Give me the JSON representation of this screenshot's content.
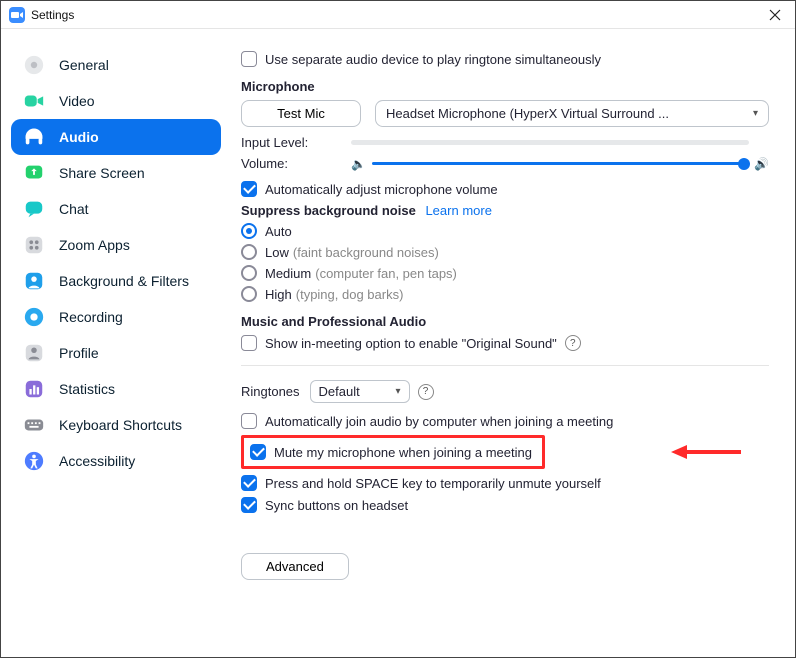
{
  "window": {
    "title": "Settings"
  },
  "sidebar": {
    "items": [
      {
        "label": "General"
      },
      {
        "label": "Video"
      },
      {
        "label": "Audio"
      },
      {
        "label": "Share Screen"
      },
      {
        "label": "Chat"
      },
      {
        "label": "Zoom Apps"
      },
      {
        "label": "Background & Filters"
      },
      {
        "label": "Recording"
      },
      {
        "label": "Profile"
      },
      {
        "label": "Statistics"
      },
      {
        "label": "Keyboard Shortcuts"
      },
      {
        "label": "Accessibility"
      }
    ]
  },
  "audio": {
    "separate_ringtone_label": "Use separate audio device to play ringtone simultaneously",
    "mic_heading": "Microphone",
    "test_mic_label": "Test Mic",
    "mic_device": "Headset Microphone (HyperX Virtual Surround ...",
    "input_level_label": "Input Level:",
    "volume_label": "Volume:",
    "auto_adjust_label": "Automatically adjust microphone volume",
    "suppress_heading": "Suppress background noise",
    "learn_more": "Learn more",
    "noise": {
      "auto": "Auto",
      "low": "Low",
      "low_hint": "(faint background noises)",
      "medium": "Medium",
      "medium_hint": "(computer fan, pen taps)",
      "high": "High",
      "high_hint": "(typing, dog barks)"
    },
    "music_heading": "Music and Professional Audio",
    "original_sound_label": "Show in-meeting option to enable \"Original Sound\"",
    "ringtones_label": "Ringtones",
    "ringtones_value": "Default",
    "auto_join_label": "Automatically join audio by computer when joining a meeting",
    "mute_on_join_label": "Mute my microphone when joining a meeting",
    "space_unmute_label": "Press and hold SPACE key to temporarily unmute yourself",
    "sync_headset_label": "Sync buttons on headset",
    "advanced_label": "Advanced"
  }
}
